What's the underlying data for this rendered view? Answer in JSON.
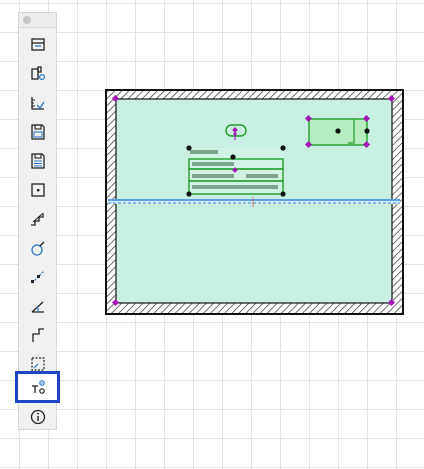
{
  "colors": {
    "accent": "#1f44c8",
    "room_fill": "#c8efe1",
    "selection_green": "#1f9e2b",
    "handle_purple": "#a318b3",
    "beam_blue": "#2f86d8"
  },
  "toolbar": {
    "tools": [
      {
        "name": "zone-table-tool",
        "icon": "zone-table-icon",
        "selected": false
      },
      {
        "name": "object-properties-tool",
        "icon": "object-properties-icon",
        "selected": false
      },
      {
        "name": "dimension-tool",
        "icon": "dimension-icon",
        "selected": false
      },
      {
        "name": "save-view-tool",
        "icon": "save-view-icon",
        "selected": false
      },
      {
        "name": "save-layout-tool",
        "icon": "save-layout-icon",
        "selected": false
      },
      {
        "name": "hotspot-tool",
        "icon": "hotspot-icon",
        "selected": false
      },
      {
        "name": "stair-tool",
        "icon": "stair-icon",
        "selected": false
      },
      {
        "name": "arc-tool",
        "icon": "arc-icon",
        "selected": false
      },
      {
        "name": "marker-path-tool",
        "icon": "marker-path-icon",
        "selected": false
      },
      {
        "name": "angle-tool",
        "icon": "angle-icon",
        "selected": false
      },
      {
        "name": "polyline-tool",
        "icon": "polyline-icon",
        "selected": false
      },
      {
        "name": "crop-region-tool",
        "icon": "crop-region-icon",
        "selected": false
      },
      {
        "name": "label-tool",
        "icon": "label-icon",
        "selected": true
      },
      {
        "name": "info-tool",
        "icon": "info-icon",
        "selected": false
      }
    ]
  }
}
